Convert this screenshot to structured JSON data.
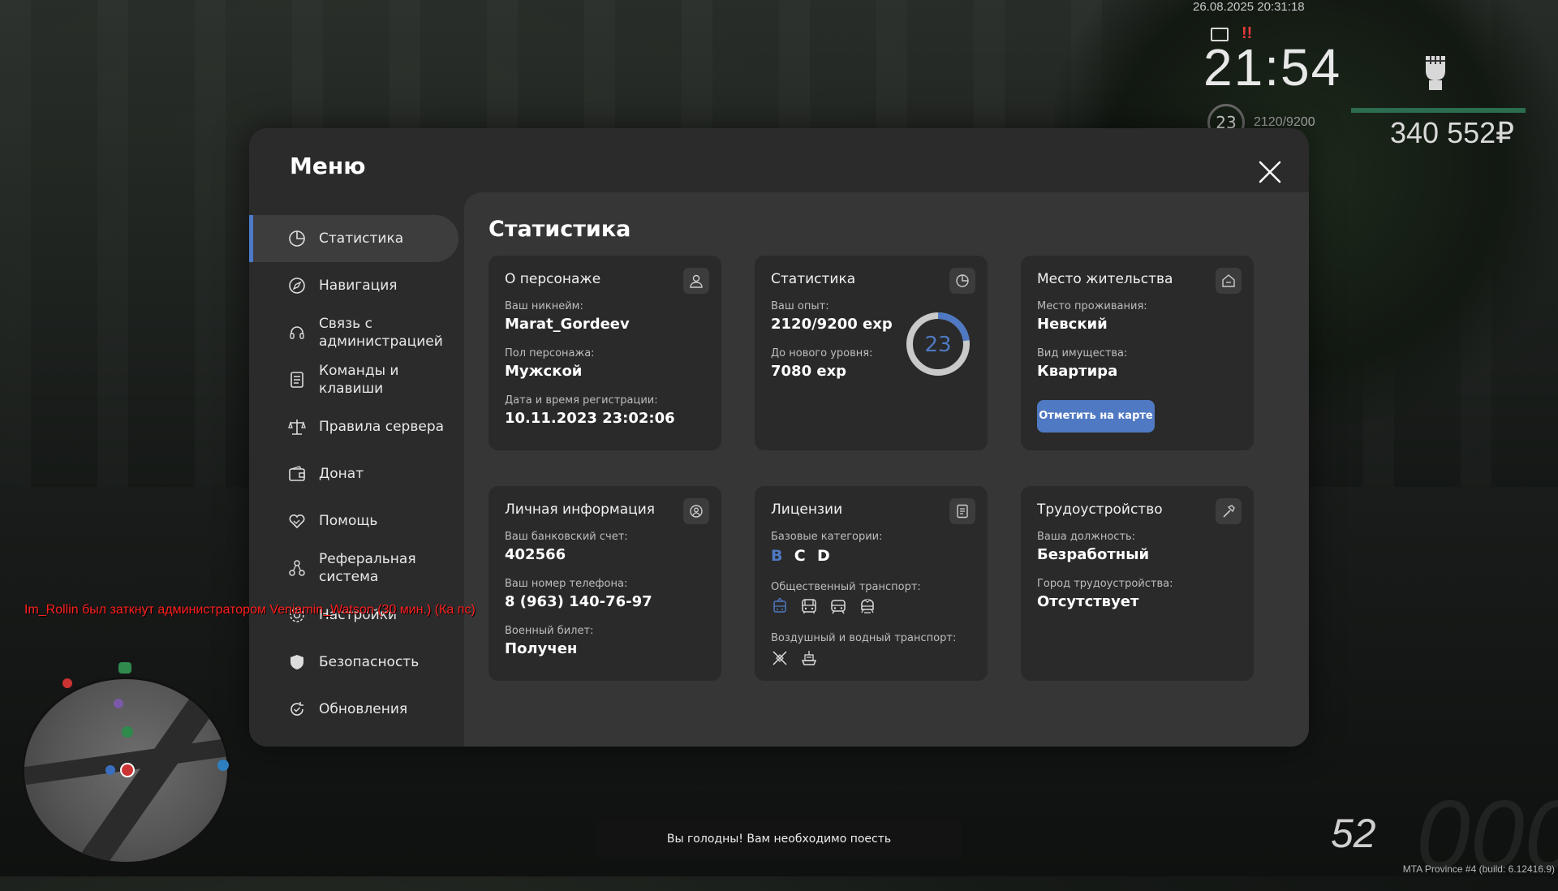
{
  "hud": {
    "datetime": "26.08.2025 20:31:18",
    "warning": "!!",
    "clock": "21:54",
    "level": "23",
    "exp": "2120/9200",
    "health_fraction": 1.0,
    "money": "340 552₽",
    "speed": "52",
    "speed_faint": "000",
    "build": "MTA Province #4 (build: 6.12416.9)"
  },
  "chat": {
    "message": "Im_Rollin был заткнут администратором Veniamin_Watson (30 мин.) (Ка пс)"
  },
  "hint": "Вы голодны! Вам необходимо поесть",
  "menu": {
    "title": "Меню",
    "section_title": "Статистика",
    "sidebar": [
      {
        "label": "Статистика",
        "icon": "stats-icon"
      },
      {
        "label": "Навигация",
        "icon": "compass-icon"
      },
      {
        "label": "Связь с администрацией",
        "icon": "headset-icon"
      },
      {
        "label": "Команды и клавиши",
        "icon": "list-icon"
      },
      {
        "label": "Правила сервера",
        "icon": "scales-icon"
      },
      {
        "label": "Донат",
        "icon": "wallet-icon"
      },
      {
        "label": "Помощь",
        "icon": "handshake-icon"
      },
      {
        "label": "Реферальная система",
        "icon": "referral-icon"
      },
      {
        "label": "Настройки",
        "icon": "gear-icon"
      },
      {
        "label": "Безопасность",
        "icon": "shield-icon"
      },
      {
        "label": "Обновления",
        "icon": "update-icon"
      }
    ],
    "cards": {
      "character": {
        "title": "О персонаже",
        "nick_label": "Ваш никнейм:",
        "nick": "Marat_Gordeev",
        "gender_label": "Пол персонажа:",
        "gender": "Мужской",
        "reg_label": "Дата и время регистрации:",
        "reg": "10.11.2023 23:02:06"
      },
      "stats": {
        "title": "Статистика",
        "exp_label": "Ваш опыт:",
        "exp": "2120/9200 exp",
        "next_label": "До нового уровня:",
        "next": "7080 exp",
        "level": "23",
        "progress": 0.23,
        "accent": "#4f79c2"
      },
      "residence": {
        "title": "Место жительства",
        "place_label": "Место проживания:",
        "place": "Невский",
        "property_label": "Вид имущества:",
        "property": "Квартира",
        "button": "Отметить на карте"
      },
      "personal": {
        "title": "Личная информация",
        "bank_label": "Ваш банковский счет:",
        "bank": "402566",
        "phone_label": "Ваш номер телефона:",
        "phone": "8 (963) 140-76-97",
        "military_label": "Военный билет:",
        "military": "Получен"
      },
      "licenses": {
        "title": "Лицензии",
        "base_label": "Базовые категории:",
        "categories": [
          "B",
          "C",
          "D"
        ],
        "public_label": "Общественный транспорт:",
        "public_icons": [
          "trolleybus-icon",
          "bus-icon",
          "tram-icon",
          "metro-icon"
        ],
        "air_label": "Воздушный и водный транспорт:",
        "air_icons": [
          "plane-icon",
          "ship-icon"
        ]
      },
      "job": {
        "title": "Трудоустройство",
        "position_label": "Ваша должность:",
        "position": "Безработный",
        "city_label": "Город трудоустройства:",
        "city": "Отсутствует"
      }
    }
  }
}
